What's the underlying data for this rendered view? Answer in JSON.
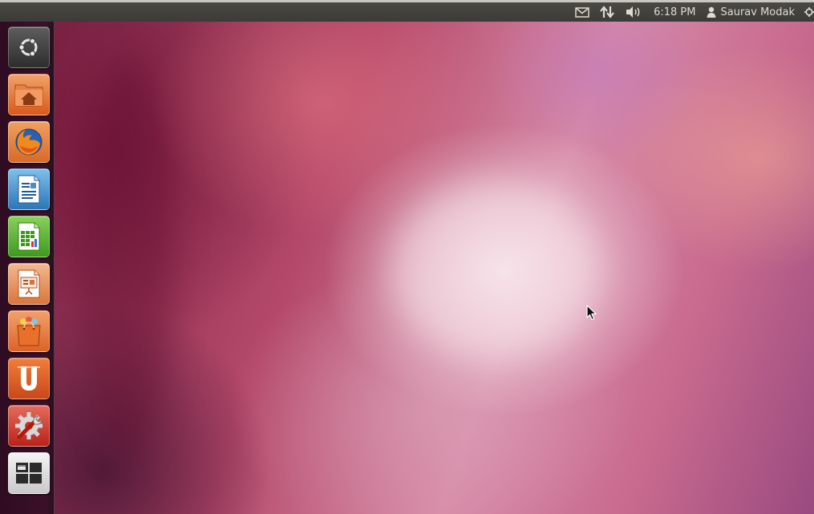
{
  "panel": {
    "indicators": [
      {
        "name": "messaging-indicator",
        "icon": "envelope-icon"
      },
      {
        "name": "network-indicator",
        "icon": "network-arrows-icon"
      },
      {
        "name": "sound-indicator",
        "icon": "speaker-icon"
      }
    ],
    "clock": "6:18 PM",
    "user_name": "Saurav Modak",
    "user_icon": "person-icon",
    "session_icon": "gear-icon"
  },
  "launcher": {
    "items": [
      {
        "name": "dash-home",
        "icon": "ubuntu-logo-icon"
      },
      {
        "name": "home-folder",
        "icon": "home-folder-icon"
      },
      {
        "name": "firefox",
        "icon": "firefox-icon"
      },
      {
        "name": "libreoffice-writer",
        "icon": "writer-document-icon"
      },
      {
        "name": "libreoffice-calc",
        "icon": "calc-spreadsheet-icon"
      },
      {
        "name": "libreoffice-impress",
        "icon": "impress-presentation-icon"
      },
      {
        "name": "ubuntu-software-center",
        "icon": "shopping-bag-icon"
      },
      {
        "name": "ubuntu-one",
        "icon": "ubuntu-one-icon"
      },
      {
        "name": "system-settings",
        "icon": "settings-wrench-icon"
      },
      {
        "name": "workspace-switcher",
        "icon": "workspaces-icon"
      }
    ]
  },
  "colors": {
    "panel_text": "#dfdbd2",
    "panel_bg": "#3c3b37",
    "launcher_bg": "#2f0c22"
  }
}
